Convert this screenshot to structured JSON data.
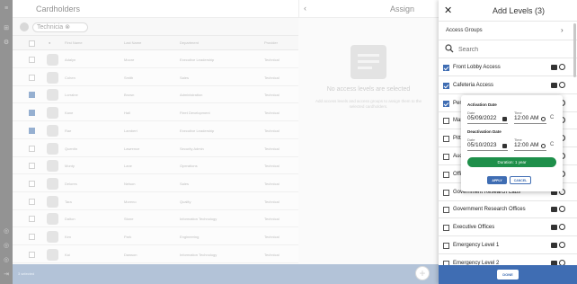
{
  "app": {
    "title": "Cardholders",
    "filter_chip": "Technicia",
    "columns": [
      "First Name",
      "Last Name",
      "Department",
      "Provider"
    ],
    "rows": [
      {
        "first": "Adalyn",
        "last": "Moore",
        "dept": "Executive Leadership",
        "prov": "Technical",
        "checked": false
      },
      {
        "first": "Cohen",
        "last": "Smith",
        "dept": "Sales",
        "prov": "Technical",
        "checked": false
      },
      {
        "first": "Lorraine",
        "last": "Brown",
        "dept": "Administration",
        "prov": "Technical",
        "checked": true
      },
      {
        "first": "Kane",
        "last": "Hall",
        "dept": "Fleet Development",
        "prov": "Technical",
        "checked": true
      },
      {
        "first": "Rae",
        "last": "Lambert",
        "dept": "Executive Leadership",
        "prov": "Technical",
        "checked": true
      },
      {
        "first": "Quentin",
        "last": "Lawrence",
        "dept": "Security Admin",
        "prov": "Technical",
        "checked": false
      },
      {
        "first": "Monty",
        "last": "Lane",
        "dept": "Operations",
        "prov": "Technical",
        "checked": false
      },
      {
        "first": "Delores",
        "last": "Nelson",
        "dept": "Sales",
        "prov": "Technical",
        "checked": false
      },
      {
        "first": "Tara",
        "last": "Moreno",
        "dept": "Quality",
        "prov": "Technical",
        "checked": false
      },
      {
        "first": "Dalton",
        "last": "Stone",
        "dept": "Information Technology",
        "prov": "Technical",
        "checked": false
      },
      {
        "first": "Ken",
        "last": "Park",
        "dept": "Engineering",
        "prov": "Technical",
        "checked": false
      },
      {
        "first": "Kai",
        "last": "Dawson",
        "dept": "Information Technology",
        "prov": "Technical",
        "checked": false
      }
    ],
    "selected_count": "3 selected",
    "assign": {
      "title": "Assign",
      "empty_msg": "No access levels are selected",
      "empty_sub": "Add access levels and access groups to assign them to the selected cardholders."
    }
  },
  "panel": {
    "title": "Add Levels (3)",
    "access_groups_label": "Access Groups",
    "search_placeholder": "Search",
    "items": [
      {
        "label": "Front Lobby Access",
        "checked": true
      },
      {
        "label": "Cafeteria Access",
        "checked": true
      },
      {
        "label": "Peri",
        "checked": true
      },
      {
        "label": "Mas",
        "checked": false
      },
      {
        "label": "Pitts",
        "checked": false
      },
      {
        "label": "Audi",
        "checked": false
      },
      {
        "label": "Offic",
        "checked": false
      },
      {
        "label": "Government Research Labs",
        "checked": false
      },
      {
        "label": "Government Research Offices",
        "checked": false
      },
      {
        "label": "Executive Offices",
        "checked": false
      },
      {
        "label": "Emergency Level 1",
        "checked": false
      },
      {
        "label": "Emergency Level 2",
        "checked": false
      }
    ],
    "done_label": "DONE"
  },
  "popup": {
    "activation_title": "Activation Date",
    "deactivation_title": "Deactivation Date",
    "date_label": "Date",
    "time_label": "Time",
    "activation_date": "05/09/2022",
    "activation_time": "12:00 AM",
    "deactivation_date": "05/10/2023",
    "deactivation_time": "12:00 AM",
    "clear_glyph": "C",
    "duration": "Duration: 1 year",
    "apply_label": "APPLY",
    "cancel_label": "CANCEL"
  },
  "colors": {
    "primary": "#3f6db3",
    "success": "#1e8f4a"
  }
}
